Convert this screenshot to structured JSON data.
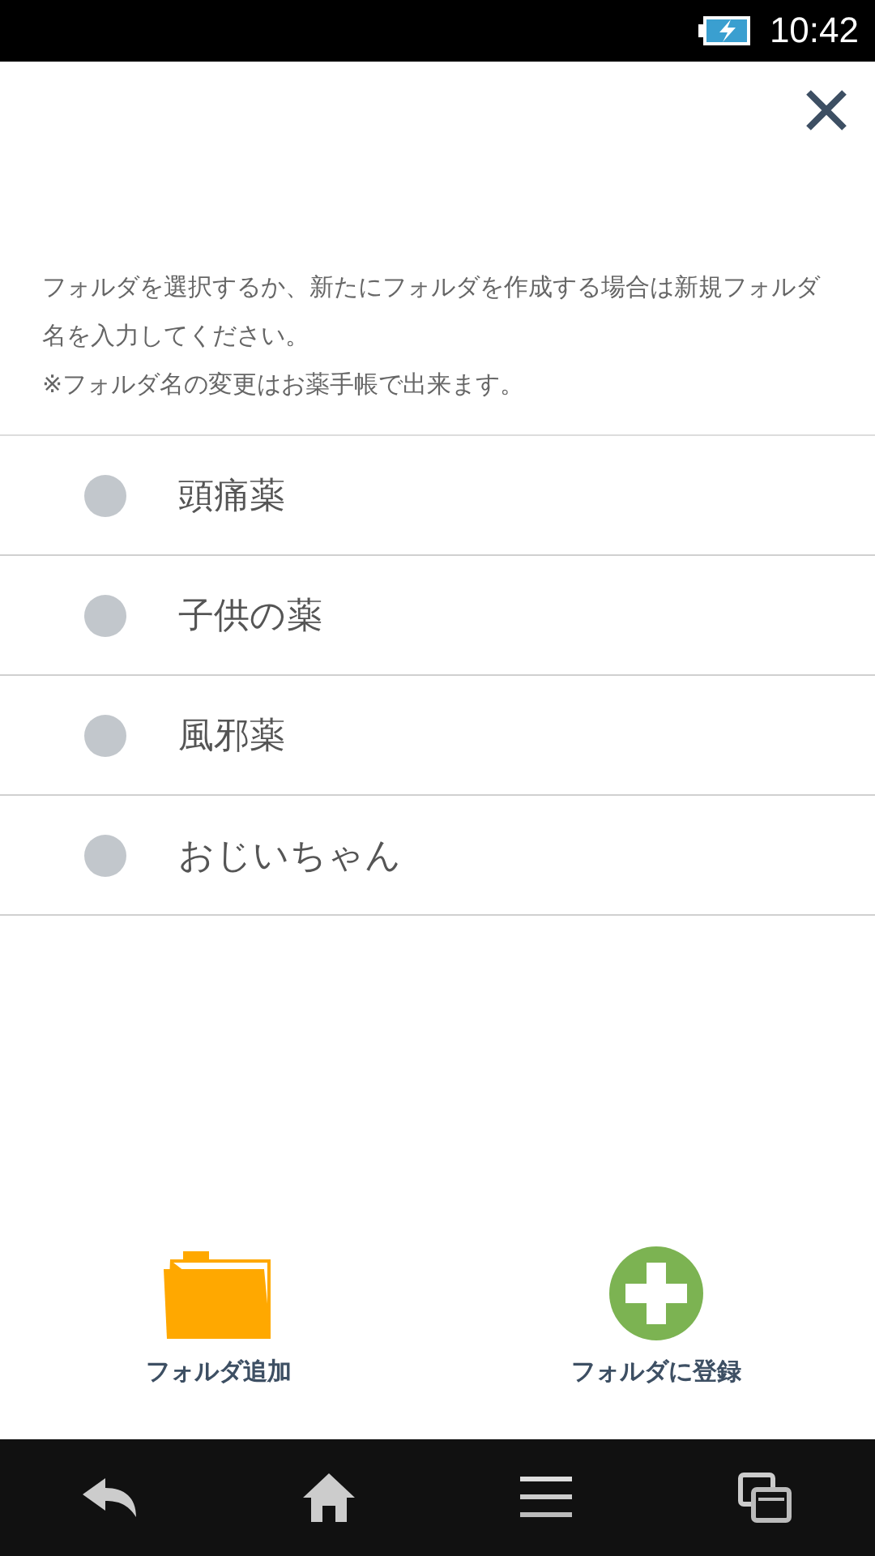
{
  "status_bar": {
    "time": "10:42"
  },
  "instructions": [
    "フォルダを選択するか、新たにフォルダを作成する場合は新規フォルダ名を入力してください。",
    "※フォルダ名の変更はお薬手帳で出来ます。"
  ],
  "folders": [
    {
      "name": "頭痛薬",
      "selected": false
    },
    {
      "name": "子供の薬",
      "selected": false
    },
    {
      "name": "風邪薬",
      "selected": false
    },
    {
      "name": "おじいちゃん",
      "selected": false
    }
  ],
  "actions": [
    {
      "kind": "folder",
      "label": "フォルダ追加"
    },
    {
      "kind": "add",
      "label": "フォルダに登録"
    }
  ]
}
